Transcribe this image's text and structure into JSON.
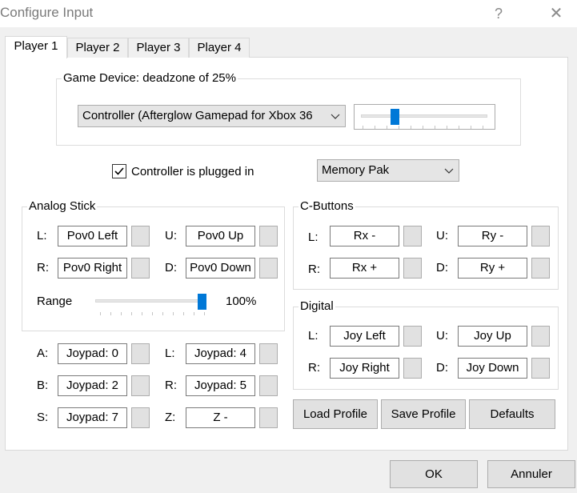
{
  "window": {
    "title": "Configure Input",
    "help_glyph": "?",
    "close_glyph": "✕"
  },
  "tabs": [
    "Player 1",
    "Player 2",
    "Player 3",
    "Player 4"
  ],
  "active_tab": "Player 1",
  "game_device": {
    "legend": "Game Device: deadzone of 25%",
    "selected": "Controller (Afterglow Gamepad for Xbox 36",
    "deadzone_percent": 25
  },
  "plugged_in": {
    "label": "Controller is plugged in",
    "checked": true
  },
  "pak": {
    "selected": "Memory Pak"
  },
  "analog_stick": {
    "legend": "Analog Stick",
    "labels": {
      "left": "L:",
      "right": "R:",
      "up": "U:",
      "down": "D:"
    },
    "values": {
      "left": "Pov0 Left",
      "right": "Pov0 Right",
      "up": "Pov0 Up",
      "down": "Pov0 Down"
    },
    "range_label": "Range",
    "range_value": "100%",
    "range_percent": 100
  },
  "c_buttons": {
    "legend": "C-Buttons",
    "labels": {
      "left": "L:",
      "right": "R:",
      "up": "U:",
      "down": "D:"
    },
    "values": {
      "left": "Rx -",
      "right": "Rx +",
      "up": "Ry -",
      "down": "Ry +"
    }
  },
  "digital": {
    "legend": "Digital",
    "labels": {
      "left": "L:",
      "right": "R:",
      "up": "U:",
      "down": "D:"
    },
    "values": {
      "left": "Joy Left",
      "right": "Joy Right",
      "up": "Joy Up",
      "down": "Joy Down"
    }
  },
  "buttons_map": {
    "labels": {
      "a": "A:",
      "b": "B:",
      "s": "S:",
      "l": "L:",
      "r": "R:",
      "z": "Z:"
    },
    "values": {
      "a": "Joypad: 0",
      "b": "Joypad: 2",
      "s": "Joypad: 7",
      "l": "Joypad: 4",
      "r": "Joypad: 5",
      "z": "Z -"
    }
  },
  "profile_buttons": {
    "load": "Load Profile",
    "save": "Save Profile",
    "defaults": "Defaults"
  },
  "dialog_buttons": {
    "ok": "OK",
    "cancel": "Annuler"
  },
  "colors": {
    "accent": "#0078d7",
    "face": "#f0f0f0",
    "page": "#ffffff"
  }
}
